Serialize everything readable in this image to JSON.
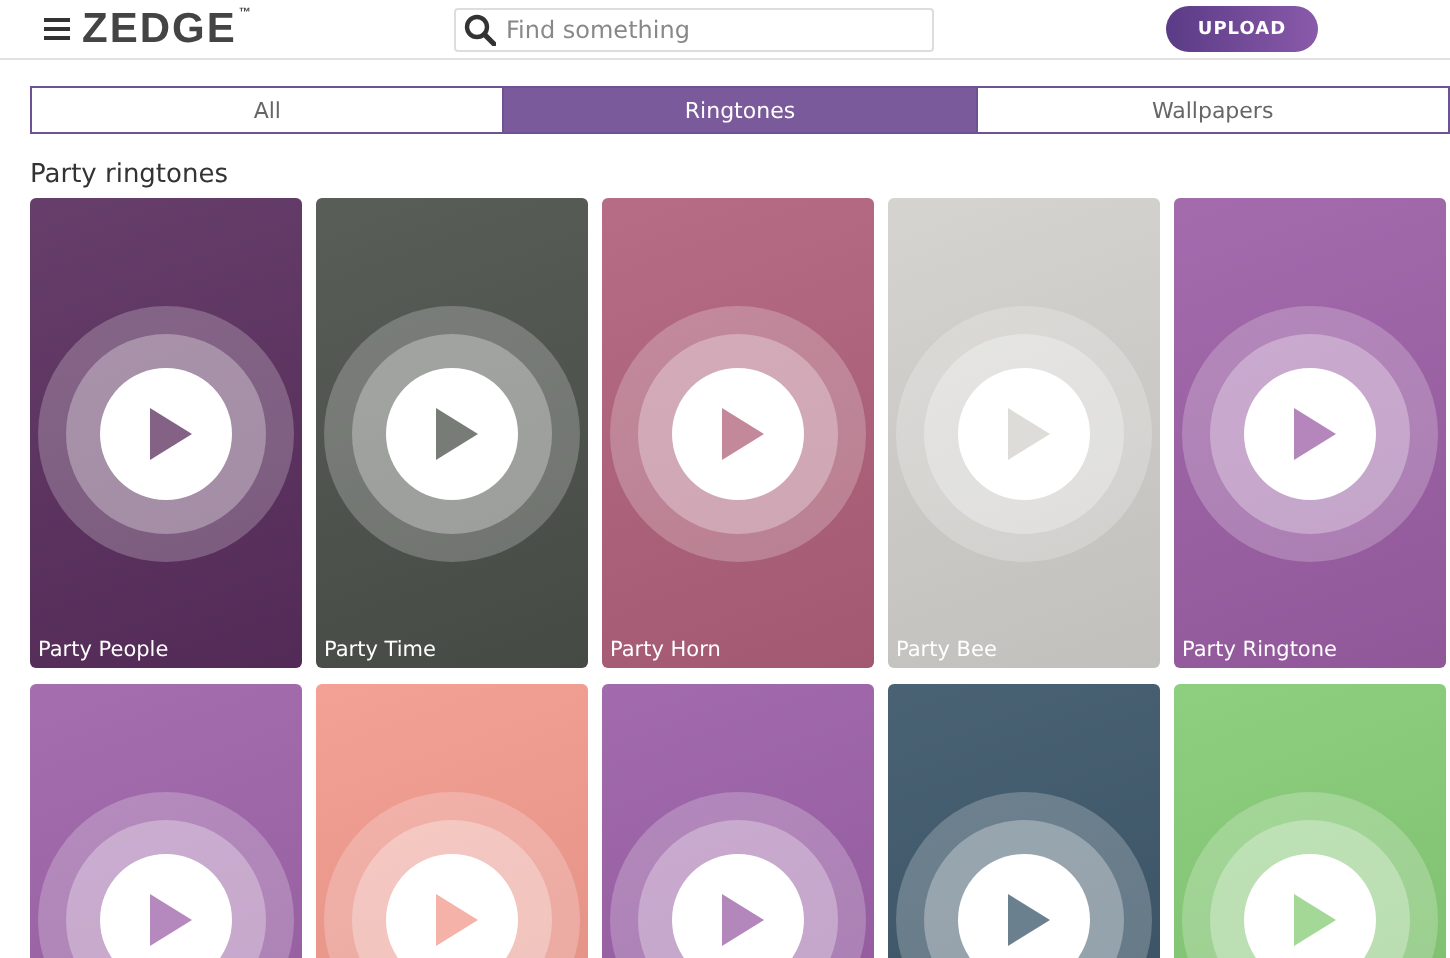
{
  "header": {
    "logo": "ZEDGE",
    "logo_mark": "™",
    "search": {
      "placeholder": "Find something"
    },
    "upload_button": "UPLOAD"
  },
  "tabs": [
    {
      "label": "All",
      "selected": false
    },
    {
      "label": "Ringtones",
      "selected": true
    },
    {
      "label": "Wallpapers",
      "selected": false
    }
  ],
  "section_title": "Party ringtones",
  "cards": [
    {
      "title": "Party People",
      "color": "#5a2e5e"
    },
    {
      "title": "Party Time",
      "color": "#4b504a"
    },
    {
      "title": "Party Horn",
      "color": "#b0607a"
    },
    {
      "title": "Party Bee",
      "color": "#d2d0cc"
    },
    {
      "title": "Party Ringtone",
      "color": "#9c5ea6"
    },
    {
      "color": "#9d62a8"
    },
    {
      "color": "#f2988c"
    },
    {
      "color": "#9a5ea6"
    },
    {
      "color": "#3a5568"
    },
    {
      "color": "#84cb74"
    }
  ]
}
